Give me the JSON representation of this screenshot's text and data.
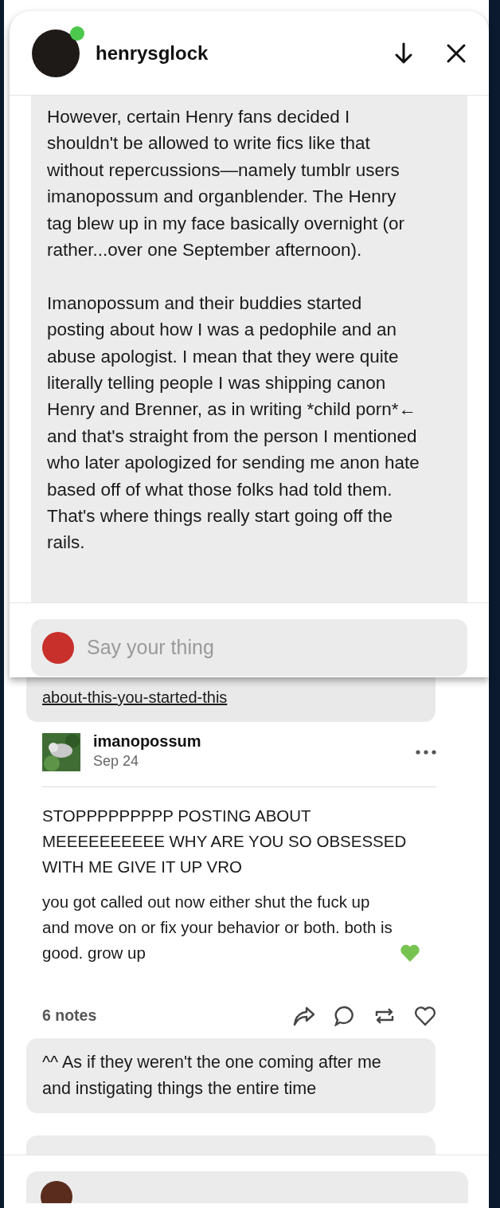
{
  "chat": {
    "username": "henrysglock",
    "online": true,
    "message_paragraphs": [
      "However, certain Henry fans decided I shouldn't be allowed to write fics like that without repercussions—namely tumblr users imanopossum and organblender. The Henry tag blew up in my face basically overnight (or rather...over one September afternoon).",
      "Imanopossum and their buddies started posting about how I was a pedophile and an abuse apologist. I mean that they were quite literally telling people I was shipping canon Henry and Brenner, as in writing *child porn*← and that's straight from the person I mentioned who later apologized for sending me anon hate based off of what those folks had told them. That's where things really start going off the rails."
    ],
    "reply_placeholder": "Say your thing"
  },
  "post": {
    "link_text": "about-this-you-started-this",
    "author": "imanopossum",
    "date": "Sep 24",
    "paragraphs": [
      "STOPPPPPPPPP POSTING ABOUT MEEEEEEEEEE WHY ARE YOU SO OBSESSED WITH ME GIVE IT UP VRO",
      "you got called out now either shut the fuck up and move on or fix your behavior or both. both is good. grow up"
    ],
    "notes": "6 notes",
    "replies": [
      "^^ As if they weren't the one coming after me and instigating things the entire time"
    ]
  }
}
